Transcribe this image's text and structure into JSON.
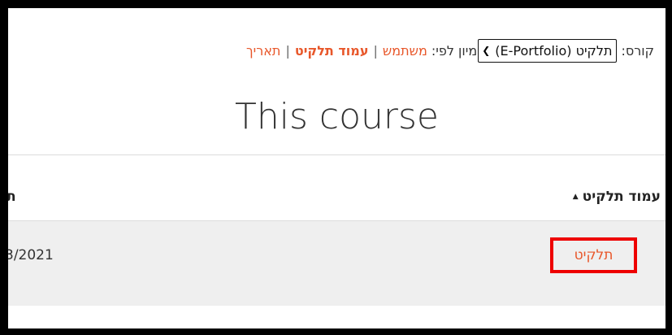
{
  "filter": {
    "course_label": "קורס:",
    "course_selected": "תלקיט (E-Portfolio)",
    "sort_label": "מיון לפי:",
    "sort_options": [
      {
        "label": "משתמש",
        "active": false
      },
      {
        "label": "עמוד תלקיט",
        "active": true
      },
      {
        "label": "תאריך",
        "active": false
      }
    ],
    "separator": "|"
  },
  "heading": "This course",
  "table": {
    "columns": [
      {
        "label": "עמוד תלקיט",
        "sorted": true,
        "sort_icon": "caret-up-icon"
      },
      {
        "label": "ת"
      }
    ],
    "rows": [
      {
        "page_link": "תלקיט",
        "date": "3/2021"
      }
    ]
  },
  "colors": {
    "link": "#e8572a",
    "highlight": "#ee0000",
    "row_bg": "#efefef"
  }
}
